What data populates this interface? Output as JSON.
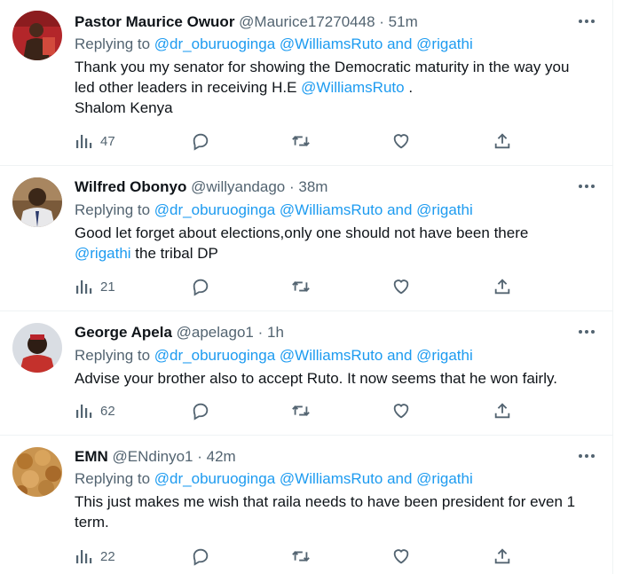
{
  "tweets": [
    {
      "name": "Pastor Maurice Owuor",
      "handle": "@Maurice17270448",
      "dot": "·",
      "time": "51m",
      "replying_prefix": "Replying to",
      "replying_to": [
        "@dr_oburuoginga",
        "@WilliamsRuto",
        "and",
        "@rigathi"
      ],
      "body_line1": "Thank you my senator for showing the Democratic maturity in the way you",
      "body_line2_text": "led other leaders in receiving H.E",
      "body_line2_mention": "@WilliamsRuto",
      "body_line2_end": ".",
      "body_line3": "Shalom Kenya",
      "views": "47"
    },
    {
      "name": "Wilfred Obonyo",
      "handle": "@willyandago",
      "dot": "·",
      "time": "38m",
      "replying_prefix": "Replying to",
      "replying_to": [
        "@dr_oburuoginga",
        "@WilliamsRuto",
        "and",
        "@rigathi"
      ],
      "body_line1": "Good let forget about elections,only one should not have been there",
      "body_line2_mention": "@rigathi",
      "body_line2_text": "the tribal DP",
      "views": "21"
    },
    {
      "name": "George Apela",
      "handle": "@apelago1",
      "dot": "·",
      "time": "1h",
      "replying_prefix": "Replying to",
      "replying_to": [
        "@dr_oburuoginga",
        "@WilliamsRuto",
        "and",
        "@rigathi"
      ],
      "body_line1": "Advise your brother also to accept Ruto. It now seems that he won fairly.",
      "views": "62"
    },
    {
      "name": "EMN",
      "handle": "@ENdinyo1",
      "dot": "·",
      "time": "42m",
      "replying_prefix": "Replying to",
      "replying_to": [
        "@dr_oburuoginga",
        "@WilliamsRuto",
        "and",
        "@rigathi"
      ],
      "body_line1": "This just makes me wish that raila needs to have been president for even 1",
      "body_line2": "term.",
      "views": "22"
    }
  ],
  "icons": {
    "views": "views-bar-chart-icon",
    "reply": "reply-bubble-icon",
    "retweet": "retweet-arrows-icon",
    "like": "heart-icon",
    "share": "share-upload-icon",
    "more": "more-dots-icon"
  },
  "colors": {
    "text": "#0f1419",
    "secondary": "#536471",
    "link": "#1d9bf0",
    "divider": "#eff3f4"
  }
}
